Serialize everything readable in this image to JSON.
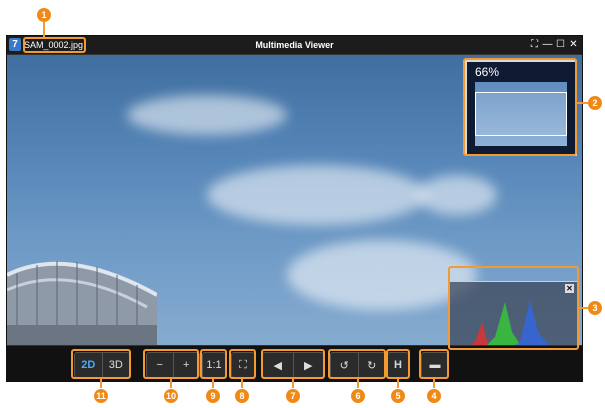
{
  "window": {
    "title": "Multimedia Viewer",
    "filename": "SAM_0002.jpg",
    "app_icon_glyph": "7",
    "buttons": [
      "⛶",
      "—",
      "☐",
      "✕"
    ]
  },
  "navigator": {
    "zoom_percent": "66%"
  },
  "histogram": {
    "close_glyph": "✕"
  },
  "toolbar": {
    "view_2d": "2D",
    "view_3d": "3D",
    "zoom_out": "−",
    "zoom_in": "+",
    "actual_size": "1:1",
    "fit": "⛶",
    "prev": "◀",
    "next": "▶",
    "rotate_left": "↺",
    "rotate_right": "↻",
    "histogram": "H",
    "open": "▬"
  },
  "callouts": [
    "1",
    "2",
    "3",
    "4",
    "5",
    "6",
    "7",
    "8",
    "9",
    "10",
    "11"
  ],
  "colors": {
    "accent": "#f08a16",
    "window_bg": "#1a1a1a",
    "sky": "#5686b8"
  }
}
